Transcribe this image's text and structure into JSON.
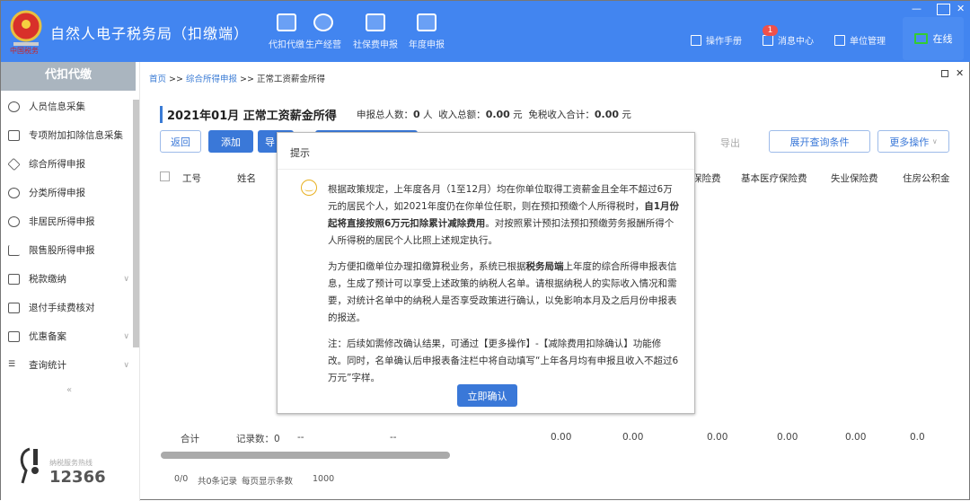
{
  "app": {
    "title": "自然人电子税务局（扣缴端）",
    "logo_text": "中国税务"
  },
  "nav": [
    {
      "label": "代扣代缴"
    },
    {
      "label": "生产经营"
    },
    {
      "label": "社保费申报"
    },
    {
      "label": "年度申报"
    }
  ],
  "tools": {
    "manual": "操作手册",
    "messages": "消息中心",
    "messages_badge": "1",
    "unit": "单位管理",
    "online": "在线"
  },
  "sidebar": {
    "header": "代扣代缴",
    "items": [
      {
        "label": "人员信息采集"
      },
      {
        "label": "专项附加扣除信息采集"
      },
      {
        "label": "综合所得申报"
      },
      {
        "label": "分类所得申报"
      },
      {
        "label": "非居民所得申报"
      },
      {
        "label": "限售股所得申报"
      },
      {
        "label": "税款缴纳",
        "expandable": true
      },
      {
        "label": "退付手续费核对"
      },
      {
        "label": "优惠备案",
        "expandable": true
      },
      {
        "label": "查询统计",
        "expandable": true
      }
    ],
    "collapse": "«",
    "hotline_label": "纳税服务热线",
    "hotline_number": "12366"
  },
  "breadcrumb": {
    "home": "首页",
    "sep": ">>",
    "level1": "综合所得申报",
    "current": "正常工资薪金所得"
  },
  "page": {
    "title": "2021年01月 正常工资薪金所得",
    "count_label": "申报总人数：",
    "count": "0",
    "count_unit": "人",
    "income_label": "收入总额：",
    "income": "0.00",
    "income_unit": "元",
    "exempt_label": "免税收入合计：",
    "exempt": "0.00",
    "exempt_unit": "元"
  },
  "toolbar": {
    "back": "返回",
    "add": "添加",
    "import": "导",
    "export": "导出",
    "expand_query": "展开查询条件",
    "more": "更多操作"
  },
  "table": {
    "headers": [
      "工号",
      "姓名",
      "保险费",
      "基本医疗保险费",
      "失业保险费",
      "住房公积金"
    ],
    "total": {
      "label": "合计",
      "records_label": "记录数：",
      "records": "0",
      "dash1": "--",
      "dash2": "--",
      "values": [
        "0.00",
        "0.00",
        "0.00",
        "0.00",
        "0.00",
        "0.0"
      ]
    }
  },
  "pager": {
    "pages": "0/0",
    "total": "共0条记录",
    "per_page_label": "每页显示条数",
    "per_page": "1000"
  },
  "modal": {
    "title": "提示",
    "p1a": "根据政策规定，上年度各月（1至12月）均在你单位取得工资薪金且全年不超过6万元的居民个人，如2021年度仍在你单位任职，则在预扣预缴个人所得税时，",
    "p1b": "自1月份起将直接按照6万元扣除累计减除费用",
    "p1c": "。对按照累计预扣法预扣预缴劳务报酬所得个人所得税的居民个人比照上述规定执行。",
    "p2a": "为方便扣缴单位办理扣缴算税业务，系统已根据",
    "p2b": "税务局端",
    "p2c": "上年度的综合所得申报表信息，生成了预计可以享受上述政策的纳税人名单。请根据纳税人的实际收入情况和需要，对统计名单中的纳税人是否享受政策进行确认，以免影响本月及之后月份申报表的报送。",
    "p3": "注：后续如需修改确认结果，可通过【更多操作】-【减除费用扣除确认】功能修改。同时，名单确认后申报表备注栏中将自动填写“上年各月均有申报且收入不超过6万元”字样。",
    "confirm": "立即确认"
  }
}
